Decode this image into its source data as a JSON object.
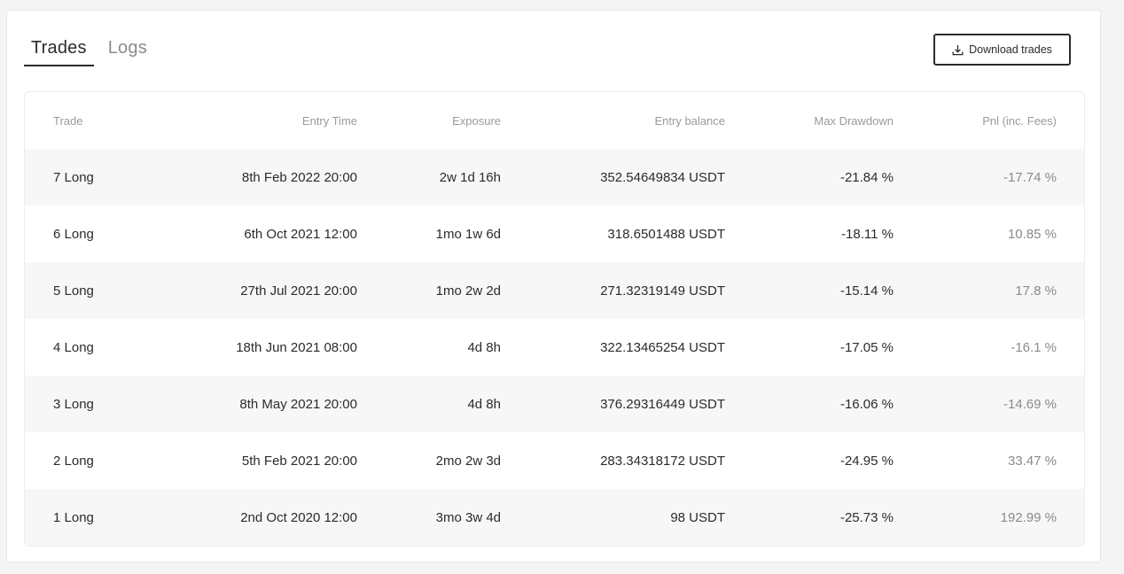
{
  "tabs": [
    {
      "label": "Trades",
      "active": true
    },
    {
      "label": "Logs",
      "active": false
    }
  ],
  "download_button": {
    "label": "Download trades",
    "icon": "download-icon"
  },
  "table": {
    "headers": {
      "trade": "Trade",
      "entry_time": "Entry Time",
      "exposure": "Exposure",
      "entry_balance": "Entry balance",
      "max_drawdown": "Max Drawdown",
      "pnl": "Pnl (inc. Fees)"
    },
    "rows": [
      {
        "trade": "7 Long",
        "entry_time": "8th Feb 2022 20:00",
        "exposure": "2w 1d 16h",
        "entry_balance": "352.54649834 USDT",
        "max_drawdown": "-21.84 %",
        "pnl": "-17.74 %"
      },
      {
        "trade": "6 Long",
        "entry_time": "6th Oct 2021 12:00",
        "exposure": "1mo 1w 6d",
        "entry_balance": "318.6501488 USDT",
        "max_drawdown": "-18.11 %",
        "pnl": "10.85 %"
      },
      {
        "trade": "5 Long",
        "entry_time": "27th Jul 2021 20:00",
        "exposure": "1mo 2w 2d",
        "entry_balance": "271.32319149 USDT",
        "max_drawdown": "-15.14 %",
        "pnl": "17.8 %"
      },
      {
        "trade": "4 Long",
        "entry_time": "18th Jun 2021 08:00",
        "exposure": "4d 8h",
        "entry_balance": "322.13465254 USDT",
        "max_drawdown": "-17.05 %",
        "pnl": "-16.1 %"
      },
      {
        "trade": "3 Long",
        "entry_time": "8th May 2021 20:00",
        "exposure": "4d 8h",
        "entry_balance": "376.29316449 USDT",
        "max_drawdown": "-16.06 %",
        "pnl": "-14.69 %"
      },
      {
        "trade": "2 Long",
        "entry_time": "5th Feb 2021 20:00",
        "exposure": "2mo 2w 3d",
        "entry_balance": "283.34318172 USDT",
        "max_drawdown": "-24.95 %",
        "pnl": "33.47 %"
      },
      {
        "trade": "1 Long",
        "entry_time": "2nd Oct 2020 12:00",
        "exposure": "3mo 3w 4d",
        "entry_balance": "98 USDT",
        "max_drawdown": "-25.73 %",
        "pnl": "192.99 %"
      }
    ]
  }
}
